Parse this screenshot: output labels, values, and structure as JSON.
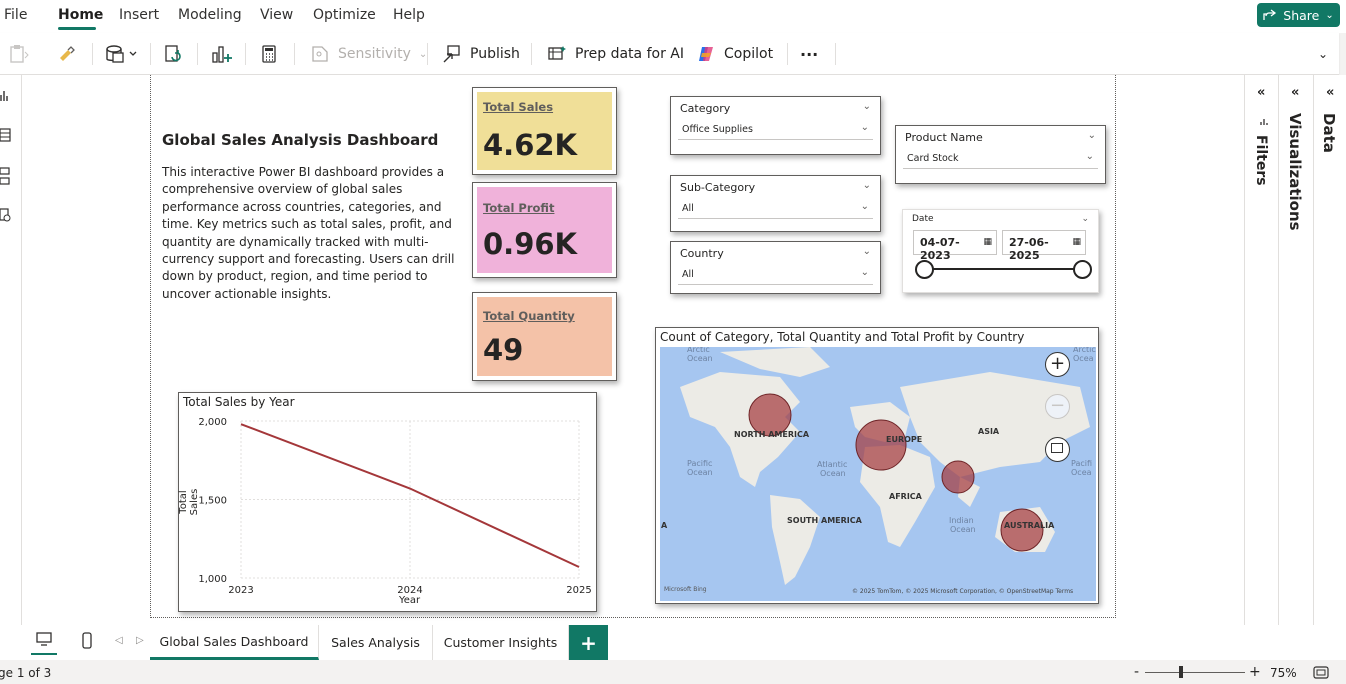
{
  "menu": {
    "items": [
      "File",
      "Home",
      "Insert",
      "Modeling",
      "View",
      "Optimize",
      "Help"
    ],
    "active": "Home",
    "share_label": "Share"
  },
  "ribbon": {
    "sensitivity_label": "Sensitivity",
    "publish_label": "Publish",
    "prep_data_label": "Prep data for AI",
    "copilot_label": "Copilot",
    "more_label": "···"
  },
  "panes": {
    "filters": "Filters",
    "visualizations": "Visualizations",
    "data": "Data"
  },
  "report": {
    "title": "Global Sales Analysis Dashboard",
    "description": "This interactive Power BI dashboard provides a comprehensive overview of global sales performance across countries, categories, and time. Key metrics such as total sales, profit, and quantity are dynamically tracked with multi-currency support and forecasting. Users can drill down by product, region, and time period to uncover actionable insights."
  },
  "cards": [
    {
      "label": "Total Sales",
      "value": "4.62K",
      "color": "#f0df98"
    },
    {
      "label": "Total Profit",
      "value": "0.96K",
      "color": "#f0b2da"
    },
    {
      "label": "Total Quantity",
      "value": "49",
      "color": "#f4c2a8"
    }
  ],
  "slicers": {
    "category": {
      "title": "Category",
      "value": "Office Supplies"
    },
    "subcategory": {
      "title": "Sub-Category",
      "value": "All"
    },
    "country": {
      "title": "Country",
      "value": "All"
    },
    "product": {
      "title": "Product Name",
      "value": "Card Stock"
    },
    "date": {
      "title": "Date",
      "start": "04-07-2023",
      "end": "27-06-2025"
    }
  },
  "line_chart": {
    "title": "Total Sales by Year",
    "xlabel": "Year",
    "ylabel": "Total Sales",
    "yticks": [
      "2,000",
      "1,500",
      "1,000"
    ],
    "xticks": [
      "2023",
      "2024",
      "2025"
    ]
  },
  "map_chart": {
    "title": "Count of Category, Total Quantity and Total Profit by Country",
    "labels": {
      "arctic_left": "Arctic\nOcean",
      "arctic_right": "Arctic\nOcea",
      "north_america": "NORTH AMERICA",
      "europe": "EUROPE",
      "asia": "ASIA",
      "africa": "AFRICA",
      "south_america": "SOUTH AMERICA",
      "australia": "AUSTRALIA",
      "pacific_left": "Pacific\nOcean",
      "pacific_right": "Pacifi\nOcea",
      "atlantic": "Atlantic\nOcean",
      "indian": "Indian\nOcean",
      "edge_a": "A"
    },
    "copyright": "© 2025 TomTom, © 2025 Microsoft Corporation, © OpenStreetMap  Terms",
    "bing": "Microsoft Bing"
  },
  "chart_data": {
    "type": "line",
    "title": "Total Sales by Year",
    "xlabel": "Year",
    "ylabel": "Total Sales",
    "x": [
      2023,
      2024,
      2025
    ],
    "series": [
      {
        "values": [
          1980,
          1570,
          1070
        ]
      }
    ],
    "ylim": [
      1000,
      2000
    ],
    "grid": true,
    "color": "#a4373a"
  },
  "tabs": {
    "items": [
      "Global Sales Dashboard",
      "Sales Analysis",
      "Customer Insights"
    ],
    "active": "Global Sales Dashboard",
    "add": "+"
  },
  "status": {
    "page": "ge 1 of 3",
    "zoom": "75%",
    "minus": "-",
    "plus": "+"
  },
  "colors": {
    "accent": "#117865",
    "bubble": "#a4373a",
    "map_water": "#a6c6f0",
    "map_land": "#ecebe6"
  }
}
